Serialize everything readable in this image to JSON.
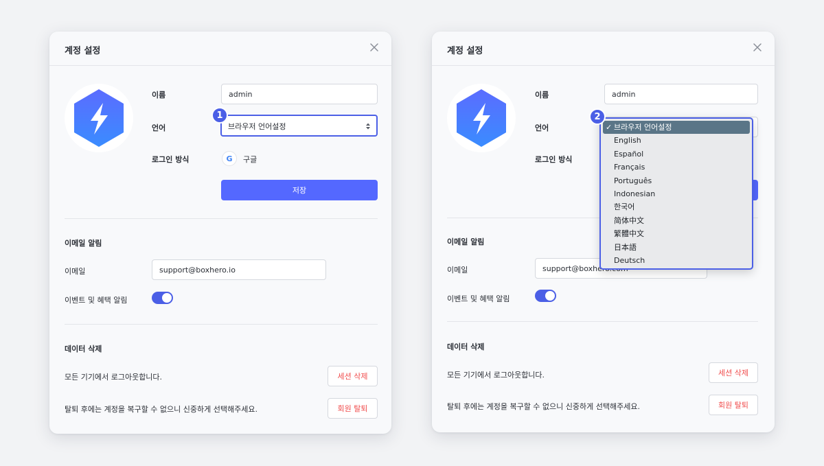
{
  "left": {
    "header": {
      "title": "계정 설정"
    },
    "profile": {
      "name_label": "이름",
      "name_value": "admin",
      "language_label": "언어",
      "language_value": "브라우저 언어설정",
      "login_label": "로그인 방식",
      "login_provider": "구글",
      "google_glyph": "G",
      "save_label": "저장"
    },
    "email_section": {
      "title": "이메일 알림",
      "email_label": "이메일",
      "email_value": "support@boxhero.io",
      "events_label": "이벤트 및 혜택 알림"
    },
    "data_section": {
      "title": "데이터 삭제",
      "logout_text": "모든 기기에서 로그아웃합니다.",
      "session_button": "세션 삭제",
      "withdraw_text": "탈퇴 후에는 계정을 복구할 수 없으니 신중하게 선택해주세요.",
      "withdraw_button": "회원 탈퇴"
    },
    "step": "1"
  },
  "right": {
    "header": {
      "title": "계정 설정"
    },
    "profile": {
      "name_label": "이름",
      "name_value": "admin",
      "language_label": "언어",
      "login_label": "로그인 방식"
    },
    "email_section": {
      "title": "이메일 알림",
      "email_label": "이메일",
      "email_value": "support@boxhero.com",
      "events_label": "이벤트 및 혜택 알림"
    },
    "data_section": {
      "title": "데이터 삭제",
      "logout_text": "모든 기기에서 로그아웃합니다.",
      "session_button": "세션 삭제",
      "withdraw_text": "탈퇴 후에는 계정을 복구할 수 없으니 신중하게 선택해주세요.",
      "withdraw_button": "회원 탈퇴"
    },
    "step": "2",
    "language_options": [
      "브라우저 언어설정",
      "English",
      "Español",
      "Français",
      "Português",
      "Indonesian",
      "한국어",
      "简体中文",
      "繁體中文",
      "日本語",
      "Deutsch"
    ],
    "check_glyph": "✓"
  },
  "colors": {
    "accent": "#4b5fe6",
    "primary_button": "#5468ff",
    "danger_text": "#f04d4d",
    "logo_gradient_top": "#5b6cff",
    "logo_gradient_bottom": "#3a8cff"
  },
  "icons": {
    "close": "close-icon",
    "logo": "boxhero-bolt-logo",
    "google": "google-icon",
    "select_arrows": "select-arrows-icon"
  }
}
